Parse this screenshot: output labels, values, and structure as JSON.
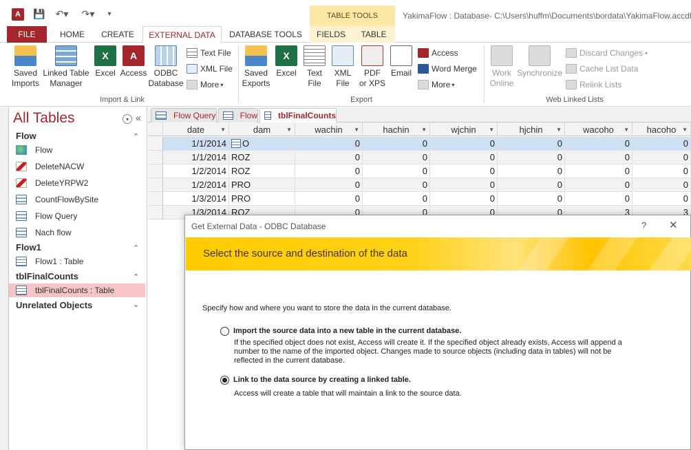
{
  "app": {
    "icon_letter": "A",
    "window_title": "YakimaFlow : Database- C:\\Users\\huffm\\Documents\\bordata\\YakimaFlow.accdb",
    "contextual_group": "TABLE TOOLS"
  },
  "tabs": [
    "FILE",
    "HOME",
    "CREATE",
    "EXTERNAL DATA",
    "DATABASE TOOLS",
    "FIELDS",
    "TABLE"
  ],
  "ribbon": {
    "import": {
      "group_label": "Import & Link",
      "saved_imports": [
        "Saved",
        "Imports"
      ],
      "linked_table_manager": [
        "Linked Table",
        "Manager"
      ],
      "excel": "Excel",
      "access": "Access",
      "odbc": [
        "ODBC",
        "Database"
      ],
      "text_file": "Text File",
      "xml_file": "XML File",
      "more": "More"
    },
    "export": {
      "group_label": "Export",
      "saved_exports": [
        "Saved",
        "Exports"
      ],
      "excel": "Excel",
      "text_file": [
        "Text",
        "File"
      ],
      "xml_file": [
        "XML",
        "File"
      ],
      "pdf": [
        "PDF",
        "or XPS"
      ],
      "email": "Email",
      "access": "Access",
      "word_merge": "Word Merge",
      "more": "More"
    },
    "web": {
      "group_label": "Web Linked Lists",
      "work_online": [
        "Work",
        "Online"
      ],
      "synchronize": "Synchronize",
      "discard_changes": "Discard Changes",
      "cache_list_data": "Cache List Data",
      "relink_lists": "Relink Lists"
    }
  },
  "nav": {
    "title": "All Tables",
    "groups": [
      {
        "name": "Flow",
        "items": [
          {
            "label": "Flow",
            "icon": "globe-icon"
          },
          {
            "label": "DeleteNACW",
            "icon": "delete-query-icon"
          },
          {
            "label": "DeleteYRPW2",
            "icon": "delete-query-icon"
          },
          {
            "label": "CountFlowBySite",
            "icon": "query-icon"
          },
          {
            "label": "Flow Query",
            "icon": "query-icon"
          },
          {
            "label": "Nach flow",
            "icon": "query-icon"
          }
        ]
      },
      {
        "name": "Flow1",
        "items": [
          {
            "label": "Flow1 : Table",
            "icon": "table-icon"
          }
        ]
      },
      {
        "name": "tblFinalCounts",
        "items": [
          {
            "label": "tblFinalCounts : Table",
            "icon": "table-icon"
          }
        ]
      },
      {
        "name": "Unrelated Objects",
        "items": []
      }
    ]
  },
  "doc_tabs": [
    "Flow Query",
    "Flow",
    "tblFinalCounts"
  ],
  "datasheet": {
    "columns": [
      "date",
      "dam",
      "wachin",
      "hachin",
      "wjchin",
      "hjchin",
      "wacoho",
      "hacoho"
    ],
    "rows": [
      [
        "1/1/2014",
        "O",
        "0",
        "0",
        "0",
        "0",
        "0",
        "0"
      ],
      [
        "1/1/2014",
        "ROZ",
        "0",
        "0",
        "0",
        "0",
        "0",
        "0"
      ],
      [
        "1/2/2014",
        "ROZ",
        "0",
        "0",
        "0",
        "0",
        "0",
        "0"
      ],
      [
        "1/2/2014",
        "PRO",
        "0",
        "0",
        "0",
        "0",
        "0",
        "0"
      ],
      [
        "1/3/2014",
        "PRO",
        "0",
        "0",
        "0",
        "0",
        "0",
        "0"
      ],
      [
        "1/3/2014",
        "ROZ",
        "0",
        "0",
        "0",
        "0",
        "3",
        "3"
      ]
    ]
  },
  "dialog": {
    "title": "Get External Data - ODBC Database",
    "help": "?",
    "heading": "Select the source and destination of the data",
    "intro": "Specify how and where you want to store the data in the current database.",
    "option_import": {
      "label": "Import the source data into a new table in the current database.",
      "desc": [
        "If the specified object does not exist, Access will create it. If the specified object already exists, Access will append a",
        "number to the name of the imported object. Changes made to source objects (including data in tables) will not be",
        "reflected in the current database."
      ]
    },
    "option_link": {
      "label": "Link to the data source by creating a linked table.",
      "desc": "Access will create a table that will maintain a link to the source data."
    }
  }
}
